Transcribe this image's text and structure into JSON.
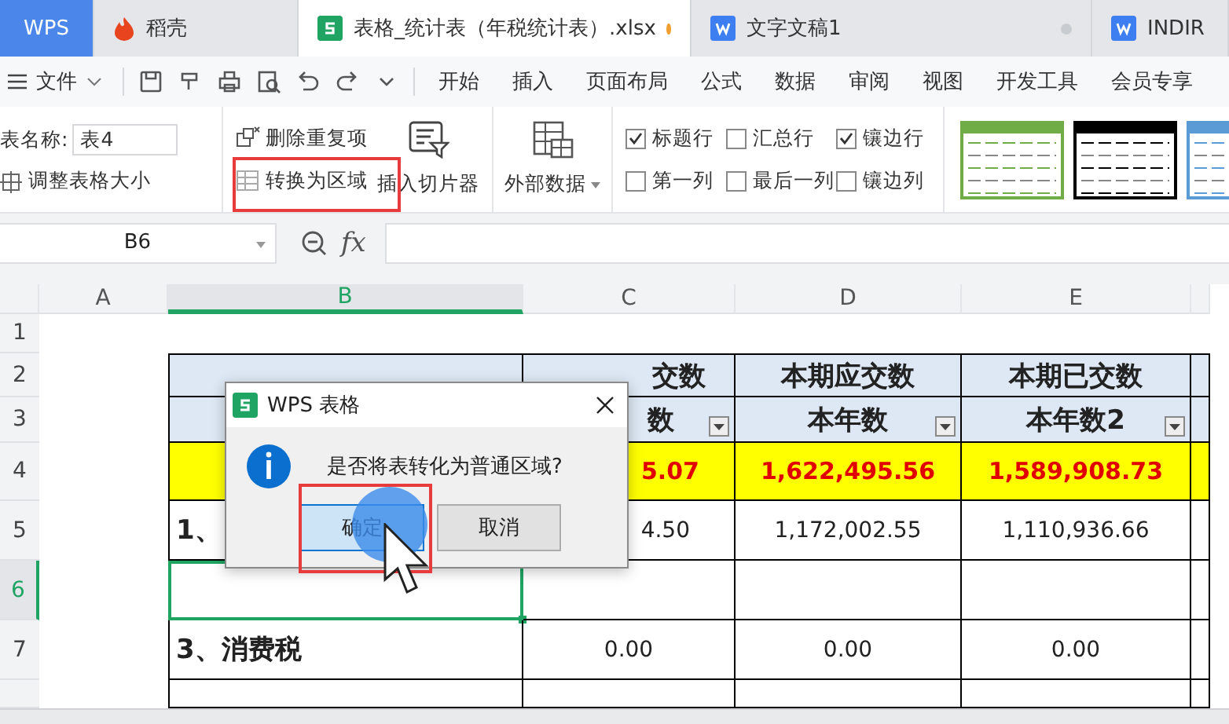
{
  "tabs": [
    {
      "label": "WPS",
      "kind": "home",
      "selected": false
    },
    {
      "label": "稻壳",
      "kind": "docer",
      "selected": false
    },
    {
      "label": "表格_统计表（年税统计表）.xlsx",
      "kind": "sheet",
      "selected": true,
      "color": "#f0a030"
    },
    {
      "label": "文字文稿1",
      "kind": "doc",
      "selected": false,
      "color": "#c8cbd0"
    },
    {
      "label": "INDIR",
      "kind": "doc",
      "selected": false
    }
  ],
  "menu": {
    "file": "文件",
    "items": [
      "开始",
      "插入",
      "页面布局",
      "公式",
      "数据",
      "审阅",
      "视图",
      "开发工具",
      "会员专享"
    ]
  },
  "ribbon": {
    "table_name_label": "表名称:",
    "table_name": "表4",
    "resize": "调整表格大小",
    "remove_duplicates": "删除重复项",
    "convert": "转换为区域",
    "slicer": "插入切片器",
    "external_data": "外部数据",
    "options": [
      {
        "label": "标题行",
        "checked": true
      },
      {
        "label": "汇总行",
        "checked": false
      },
      {
        "label": "镶边行",
        "checked": true
      },
      {
        "label": "第一列",
        "checked": false
      },
      {
        "label": "最后一列",
        "checked": false
      },
      {
        "label": "镶边列",
        "checked": false
      }
    ],
    "styles": [
      {
        "color": "#70ad47"
      },
      {
        "color": "#000000"
      },
      {
        "color": "#5b9bd5"
      }
    ]
  },
  "formula_bar": {
    "name_box": "B6",
    "function_label": "fx"
  },
  "sheet": {
    "columns": [
      {
        "label": "A",
        "selected": false
      },
      {
        "label": "B",
        "selected": true
      },
      {
        "label": "C",
        "selected": false
      },
      {
        "label": "D",
        "selected": false
      },
      {
        "label": "E",
        "selected": false
      }
    ],
    "rows": [
      {
        "label": "1",
        "selected": false,
        "kind": "blank"
      },
      {
        "label": "2",
        "selected": false,
        "kind": "header",
        "cells": [
          null,
          {
            "text": "交数",
            "cut": true
          },
          "本期应交数",
          "本期已交数"
        ]
      },
      {
        "label": "3",
        "selected": false,
        "kind": "header",
        "filter": true,
        "cells": [
          null,
          {
            "text": "数",
            "cut": true
          },
          "本年数",
          "本年数2"
        ]
      },
      {
        "label": "4",
        "selected": false,
        "kind": "total",
        "cells": [
          null,
          {
            "text": "5.07",
            "cut": true
          },
          "1,622,495.56",
          "1,589,908.73"
        ]
      },
      {
        "label": "5",
        "selected": false,
        "kind": "data",
        "cells": [
          "1、",
          {
            "text": "4.50",
            "cut": true
          },
          "1,172,002.55",
          "1,110,936.66"
        ]
      },
      {
        "label": "6",
        "selected": true,
        "kind": "data",
        "cells": [
          null,
          null,
          null,
          null
        ]
      },
      {
        "label": "7",
        "selected": false,
        "kind": "data",
        "cells": [
          "3、消费税",
          "0.00",
          "0.00",
          "0.00"
        ]
      }
    ]
  },
  "dialog": {
    "title": "WPS 表格",
    "message": "是否将表转化为普通区域?",
    "buttons": [
      {
        "label": "确定",
        "kind": "primary"
      },
      {
        "label": "取消",
        "kind": "secondary"
      }
    ]
  }
}
